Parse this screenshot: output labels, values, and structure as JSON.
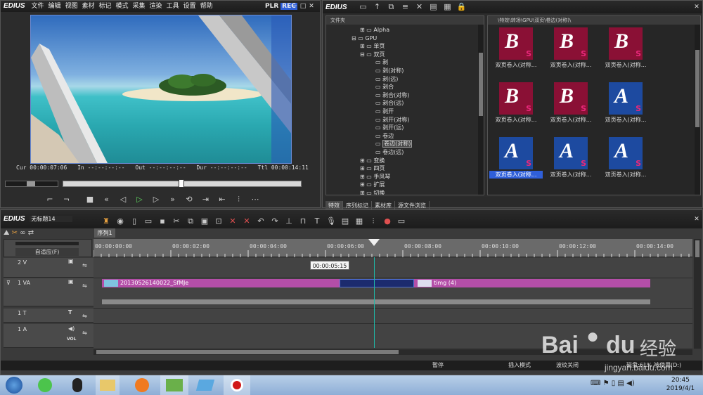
{
  "player": {
    "logo": "EDIUS",
    "menu": [
      "文件",
      "编辑",
      "视图",
      "素材",
      "标记",
      "模式",
      "采集",
      "渲染",
      "工具",
      "设置",
      "帮助"
    ],
    "plr": "PLR",
    "rec": "REC",
    "timecodes": {
      "cur_label": "Cur",
      "cur": "00:00:07:06",
      "in_label": "In",
      "in": "--:--:--:--",
      "out_label": "Out",
      "out": "--:--:--:--",
      "dur_label": "Dur",
      "dur": "--:--:--:--",
      "ttl_label": "Ttl",
      "ttl": "00:00:14:11"
    }
  },
  "library": {
    "logo": "EDIUS",
    "tree_header": "文件夹",
    "path": "\\特效\\转场\\GPU\\双页\\卷边(对称)\\",
    "tree": [
      "Alpha",
      "GPU",
      "单页",
      "双页",
      "剥",
      "剥(对称)",
      "剥(远)",
      "剥合",
      "剥合(对称)",
      "剥合(远)",
      "剥开",
      "剥开(对称)",
      "剥开(远)",
      "卷边",
      "卷边(对称)",
      "卷边(远)",
      "变换",
      "四页",
      "手风琴",
      "扩展",
      "切换"
    ],
    "thumbs": [
      {
        "letter": "B",
        "label": "双页卷入(对称..."
      },
      {
        "letter": "B",
        "label": "双页卷入(对称..."
      },
      {
        "letter": "B",
        "label": "双页卷入(对称..."
      },
      {
        "letter": "B",
        "label": "双页卷入(对称..."
      },
      {
        "letter": "B",
        "label": "双页卷入(对称..."
      },
      {
        "letter": "A",
        "label": "双页卷入(对称..."
      },
      {
        "letter": "A",
        "label": "双页卷入(对称..."
      },
      {
        "letter": "A",
        "label": "双页卷入(对称..."
      },
      {
        "letter": "A",
        "label": "双页卷入(对称..."
      }
    ],
    "tabs": [
      "特效",
      "序列标记",
      "素材库",
      "源文件浏览"
    ]
  },
  "timeline": {
    "logo": "EDIUS",
    "project": "无标题14",
    "sequence_tab": "序列1",
    "fit_label": "自适应(F)",
    "ruler": [
      "00:00:00:00",
      "00:00:02:00",
      "00:00:04:00",
      "00:00:06:00",
      "00:00:08:00",
      "00:00:10:00",
      "00:00:12:00",
      "00:00:14:00"
    ],
    "tooltip": "00:00:05:15",
    "tracks": [
      {
        "name": "2 V"
      },
      {
        "name": "1 VA"
      },
      {
        "name": "1 T"
      },
      {
        "name": "1 A"
      }
    ],
    "vol": "VOL",
    "clip1": "20130526140022_SfMJe",
    "clip2": "timg (4)",
    "status": {
      "pause": "暂停",
      "insert": "插入模式",
      "ripple": "波纹关闭",
      "disk": "磁盘:61% 被使用(D:)"
    }
  },
  "taskbar": {
    "time": "20:45",
    "date": "2019/4/1"
  },
  "watermark": {
    "brand": "Bai",
    "brand2": "du",
    "cn": "经验",
    "url": "jingyan.baidu.com"
  },
  "colors": {
    "accent": "#2a5bd8",
    "clip": "#b44ea8",
    "playhead": "#1fb9a8",
    "rec": "#2f5fd9"
  }
}
